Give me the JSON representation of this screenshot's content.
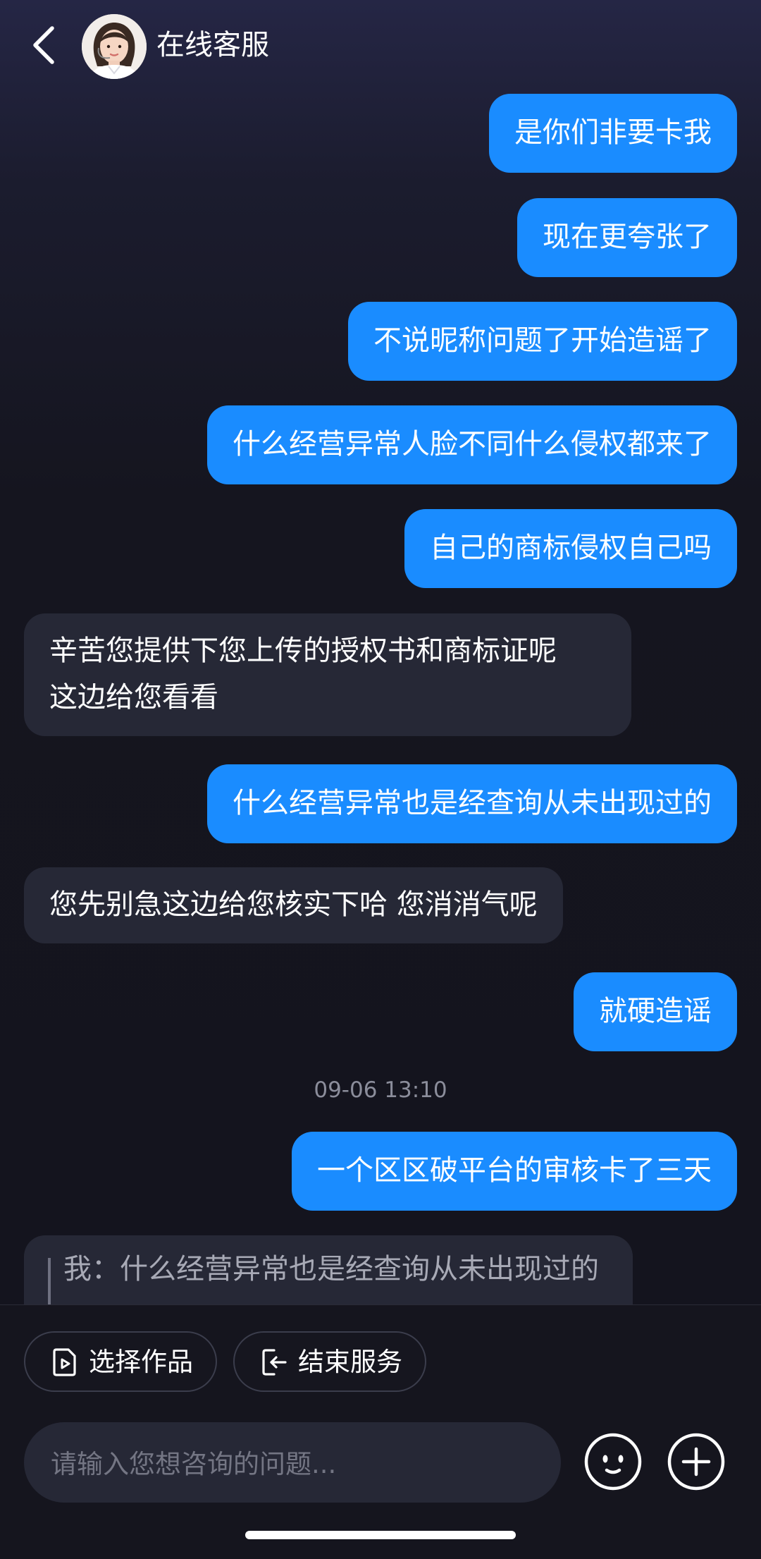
{
  "header": {
    "title": "在线客服",
    "back_icon": "chevron-left-icon",
    "avatar": "customer-service-agent-avatar"
  },
  "messages": [
    {
      "side": "out",
      "text": "是你们非要卡我"
    },
    {
      "side": "out",
      "text": "现在更夸张了"
    },
    {
      "side": "out",
      "text": "不说昵称问题了开始造谣了"
    },
    {
      "side": "out",
      "text": "什么经营异常人脸不同什么侵权都来了"
    },
    {
      "side": "out",
      "text": "自己的商标侵权自己吗"
    },
    {
      "side": "in",
      "text": "辛苦您提供下您上传的授权书和商标证呢\n这边给您看看"
    },
    {
      "side": "out",
      "text": "什么经营异常也是经查询从未出现过的"
    },
    {
      "side": "in",
      "text": "您先别急这边给您核实下哈 您消消气呢"
    },
    {
      "side": "out",
      "text": "就硬造谣"
    },
    {
      "side": "out",
      "text": "一个区区破平台的审核卡了三天"
    }
  ],
  "timestamp": "09-06 13:10",
  "quoted_reply": {
    "text": "我：什么经营异常也是经查询从未出现过的"
  },
  "actions": {
    "select_works": {
      "label": "选择作品",
      "icon": "document-play-icon"
    },
    "end_service": {
      "label": "结束服务",
      "icon": "exit-icon"
    }
  },
  "input": {
    "placeholder": "请输入您想咨询的问题...",
    "value": ""
  },
  "icons": {
    "emoji": "emoji-icon",
    "plus": "plus-circle-icon"
  },
  "colors": {
    "outgoing_bubble": "#1a8cff",
    "incoming_bubble": "#262836",
    "background": "#14141f",
    "timestamp": "#8b8d9b"
  }
}
